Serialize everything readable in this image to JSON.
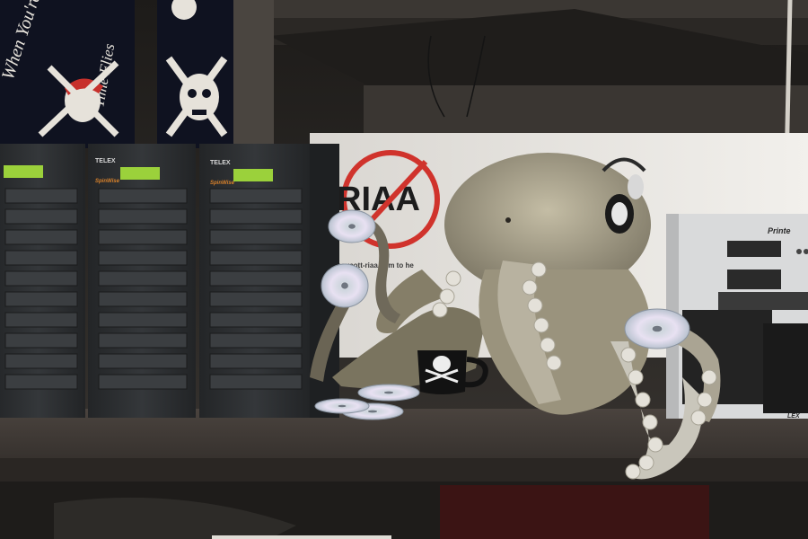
{
  "flag_left": {
    "text_line1": "When You're Ha",
    "text_line2": "Time Flies"
  },
  "duplicators": [
    {
      "brand": "",
      "sub": ""
    },
    {
      "brand": "TELEX",
      "sub": "SpinWise"
    },
    {
      "brand": "TELEX",
      "sub": "SpinWise"
    }
  ],
  "sign": {
    "riaa_text": "RIAA",
    "url_text": "boycott-riaa.com to he"
  },
  "printer": {
    "brand": "Printe",
    "label": "LEX"
  },
  "colors": {
    "ceiling": "#2a2724",
    "shelf": "#3d3733",
    "duplicator_body": "#2b2d2f",
    "lcd": "#9bd13b",
    "no_sign_red": "#d0332c",
    "octopus": "#a9a089"
  }
}
